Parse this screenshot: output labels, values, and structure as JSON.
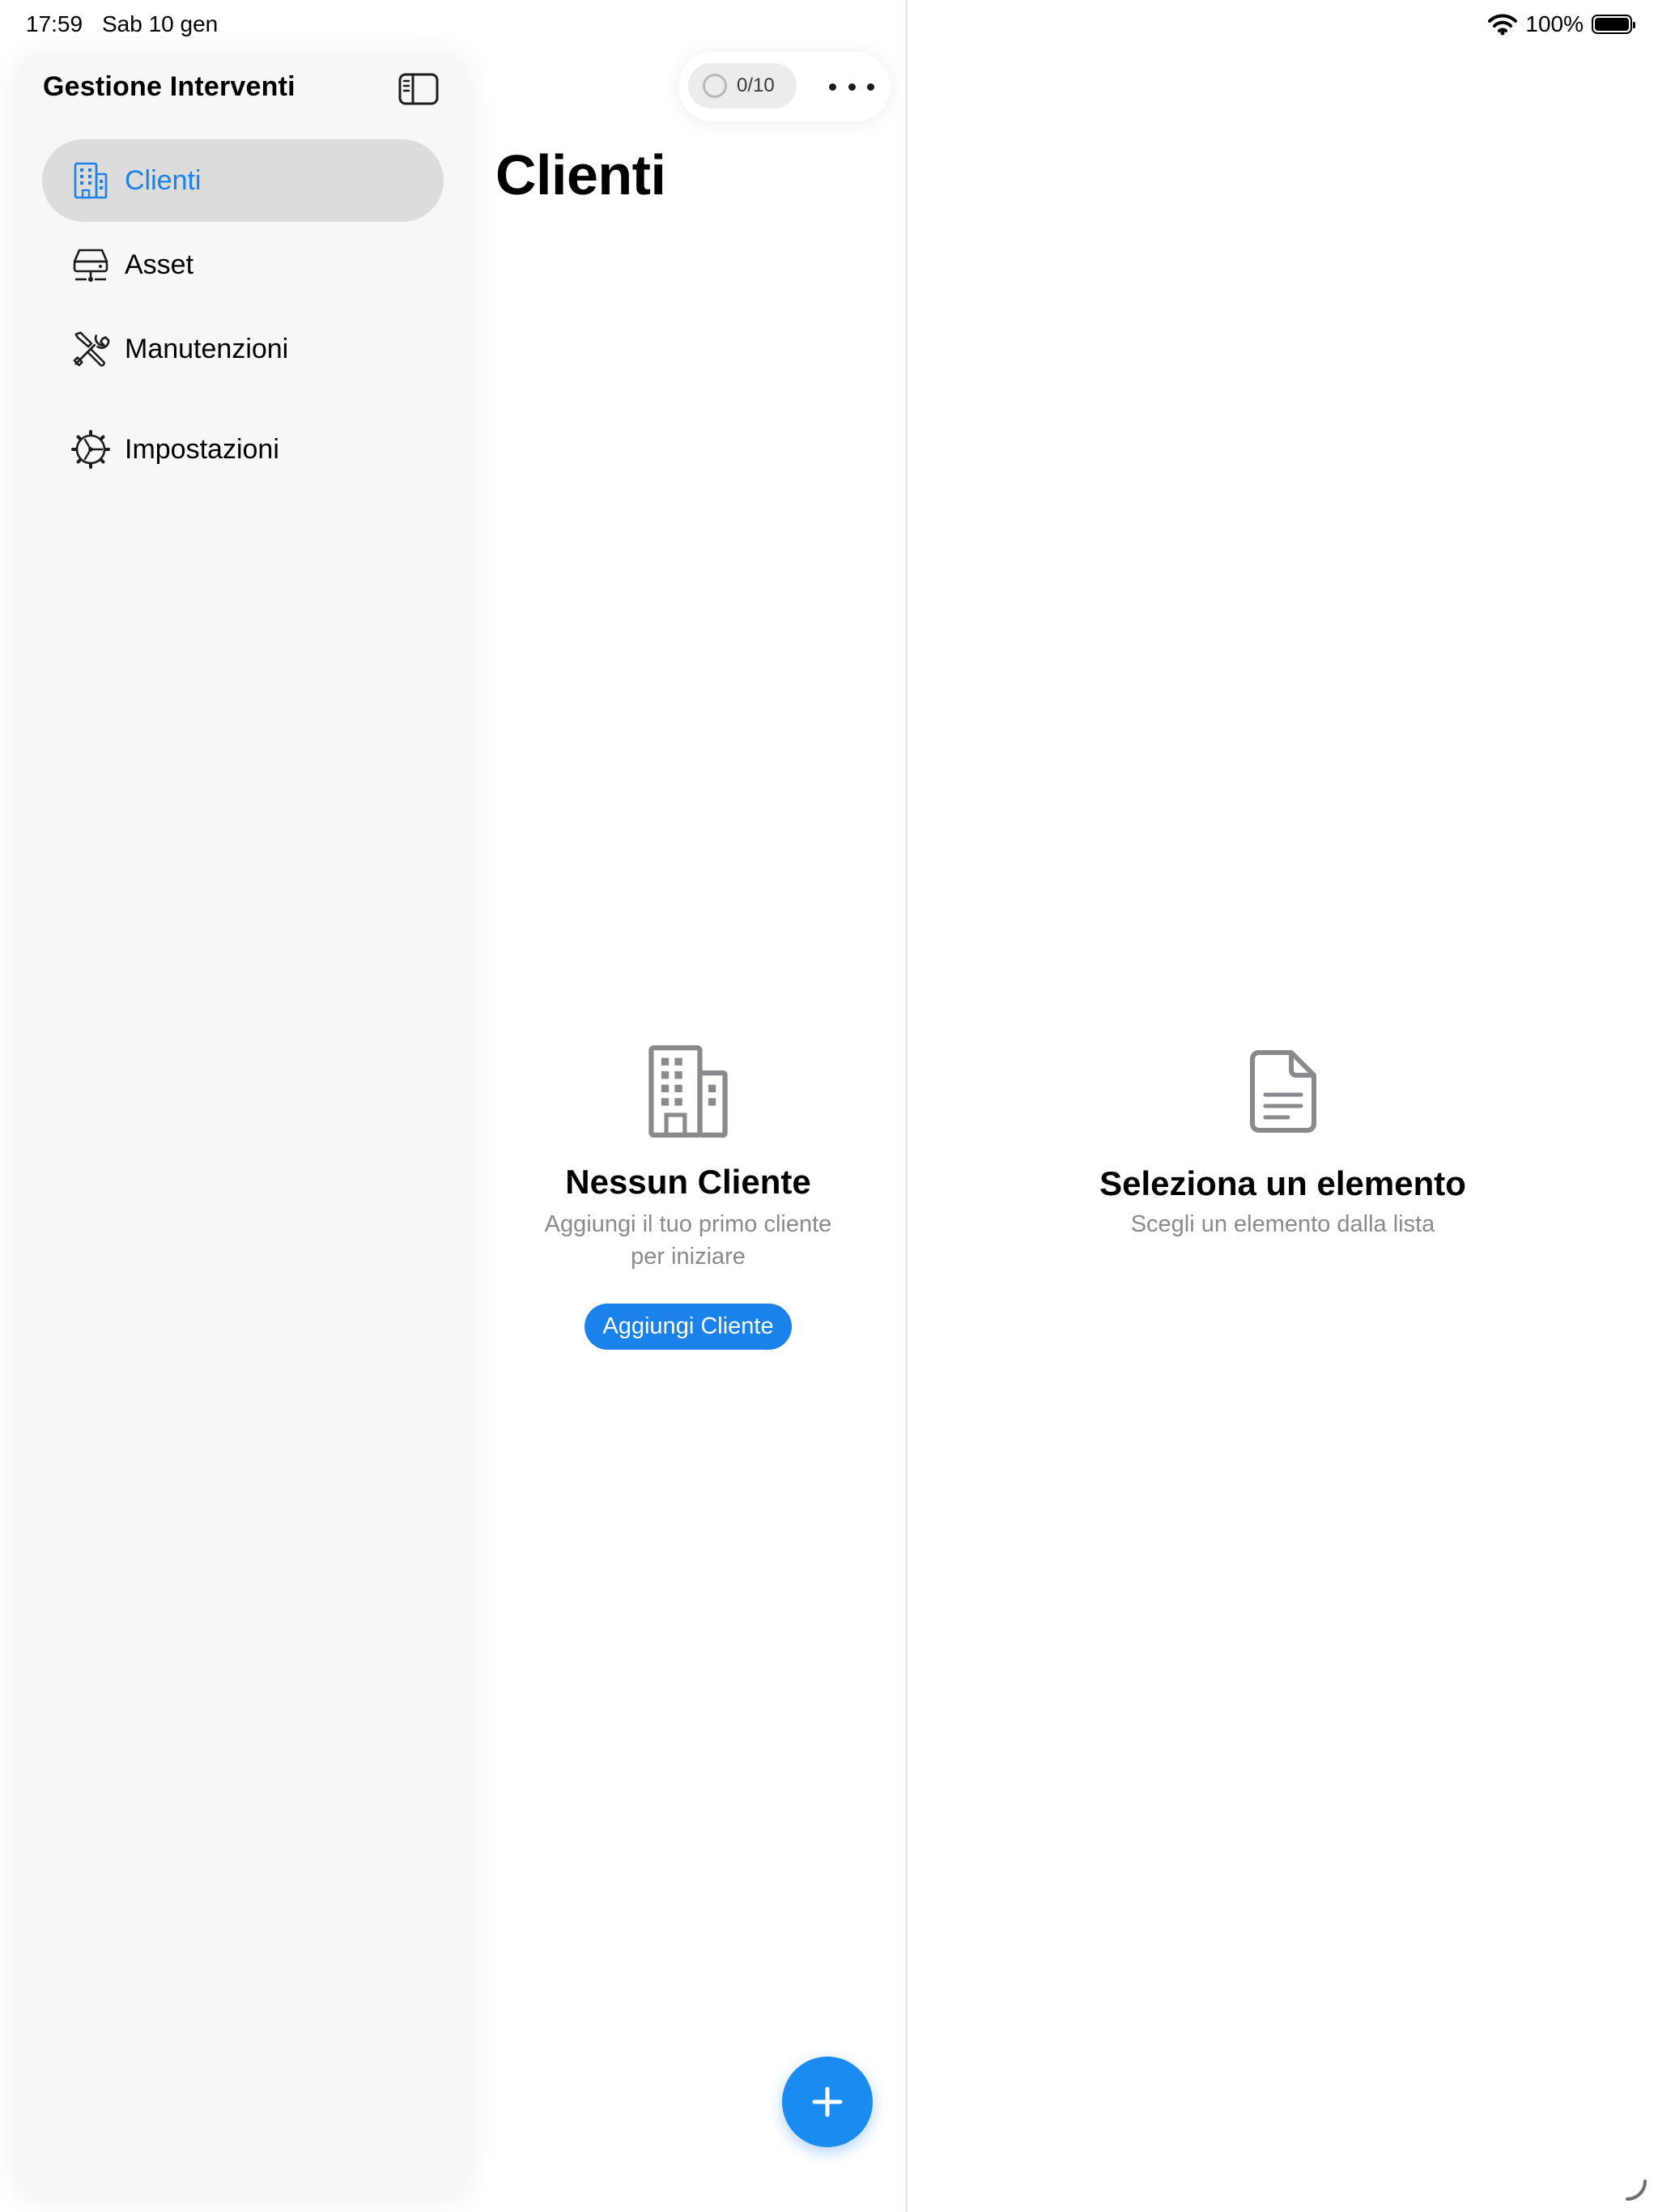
{
  "status_bar": {
    "time": "17:59",
    "date": "Sab 10 gen",
    "battery": "100%"
  },
  "sidebar": {
    "title": "Gestione Interventi",
    "items": [
      {
        "label": "Clienti",
        "icon": "building-icon",
        "active": true
      },
      {
        "label": "Asset",
        "icon": "server-icon",
        "active": false
      },
      {
        "label": "Manutenzioni",
        "icon": "tools-icon",
        "active": false
      },
      {
        "label": "Impostazioni",
        "icon": "gear-icon",
        "active": false
      }
    ]
  },
  "toolbar": {
    "progress": "0/10"
  },
  "main": {
    "title": "Clienti",
    "empty_title": "Nessun Cliente",
    "empty_subtitle": "Aggiungi il tuo primo cliente per iniziare",
    "add_button": "Aggiungi Cliente"
  },
  "detail": {
    "empty_title": "Seleziona un elemento",
    "empty_subtitle": "Scegli un elemento dalla lista"
  },
  "colors": {
    "accent": "#1a82ea",
    "secondary_text": "#8a8a8e",
    "selection": "#dcdcdc"
  }
}
